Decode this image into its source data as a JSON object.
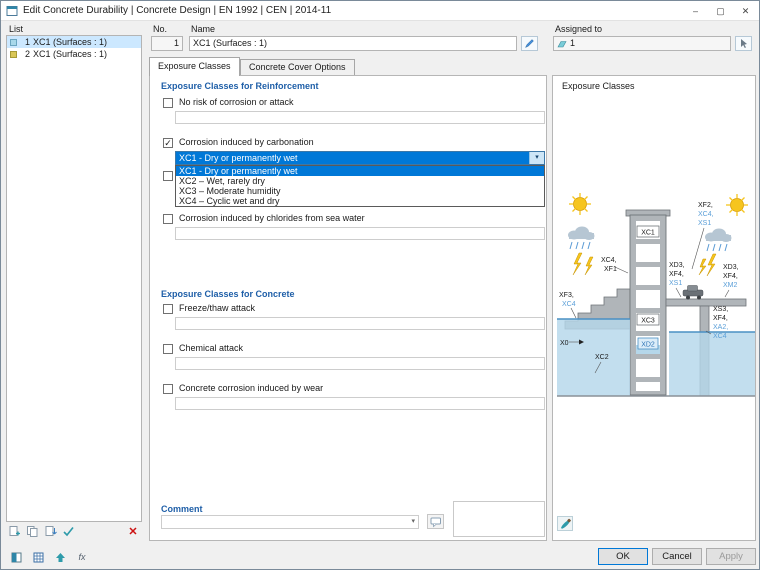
{
  "titlebar": {
    "title": "Edit Concrete Durability | Concrete Design | EN 1992 | CEN | 2014-11"
  },
  "icons": {
    "minimize": "–",
    "maximize": "▢",
    "close": "✕",
    "check": "✓",
    "delete": "✕",
    "combo_arrow": "▾",
    "formula": "fx"
  },
  "colors": {
    "accent": "#0078d7",
    "section_header": "#1f5fa8",
    "diagram_label_blue": "#5b9fd8",
    "swatch_1": "#a8d8ea",
    "swatch_2": "#d9c657"
  },
  "list_panel": {
    "label": "List",
    "items": [
      {
        "no": "1",
        "label": "XC1 (Surfaces : 1)"
      },
      {
        "no": "2",
        "label": "XC1 (Surfaces : 1)"
      }
    ]
  },
  "fields": {
    "no_label": "No.",
    "no_value": "1",
    "name_label": "Name",
    "name_value": "XC1 (Surfaces : 1)",
    "assigned_label": "Assigned to",
    "assigned_value": "1"
  },
  "tabs": {
    "exposure": "Exposure Classes",
    "cover": "Concrete Cover Options"
  },
  "form": {
    "reinforcement_header": "Exposure Classes for Reinforcement",
    "no_risk_label": "No risk of corrosion or attack",
    "carbonation_label": "Corrosion induced by carbonation",
    "carbonation_value": "XC1 - Dry or permanently wet",
    "dropdown_options": [
      "XC1 - Dry or permanently wet",
      "XC2 – Wet, rarely dry",
      "XC3 – Moderate humidity",
      "XC4 – Cyclic wet and dry"
    ],
    "sea_water_label": "Corrosion induced by chlorides from sea water",
    "concrete_header": "Exposure Classes for Concrete",
    "freeze_label": "Freeze/thaw attack",
    "chemical_label": "Chemical attack",
    "wear_label": "Concrete corrosion induced by wear",
    "comment_label": "Comment"
  },
  "diagram": {
    "title": "Exposure Classes",
    "top_right": [
      "XF2,",
      "XC4,",
      "XS1"
    ],
    "wall_left": [
      "XC4,",
      "XF1"
    ],
    "deck_left": [
      "XD3,",
      "XF4,",
      "XS1"
    ],
    "deck_right": [
      "XD3,",
      "XF4,",
      "XM2"
    ],
    "splash_right": [
      "XS3,",
      "XF4,",
      "XA2,",
      "XC4"
    ],
    "waterline_left": [
      "XF3,",
      "XC4"
    ],
    "interior_top": "XC1",
    "interior_mid": "XC3",
    "tank": "XD2",
    "dry": "X0",
    "foundation": "XC2"
  },
  "footer": {
    "ok": "OK",
    "cancel": "Cancel",
    "apply": "Apply"
  }
}
